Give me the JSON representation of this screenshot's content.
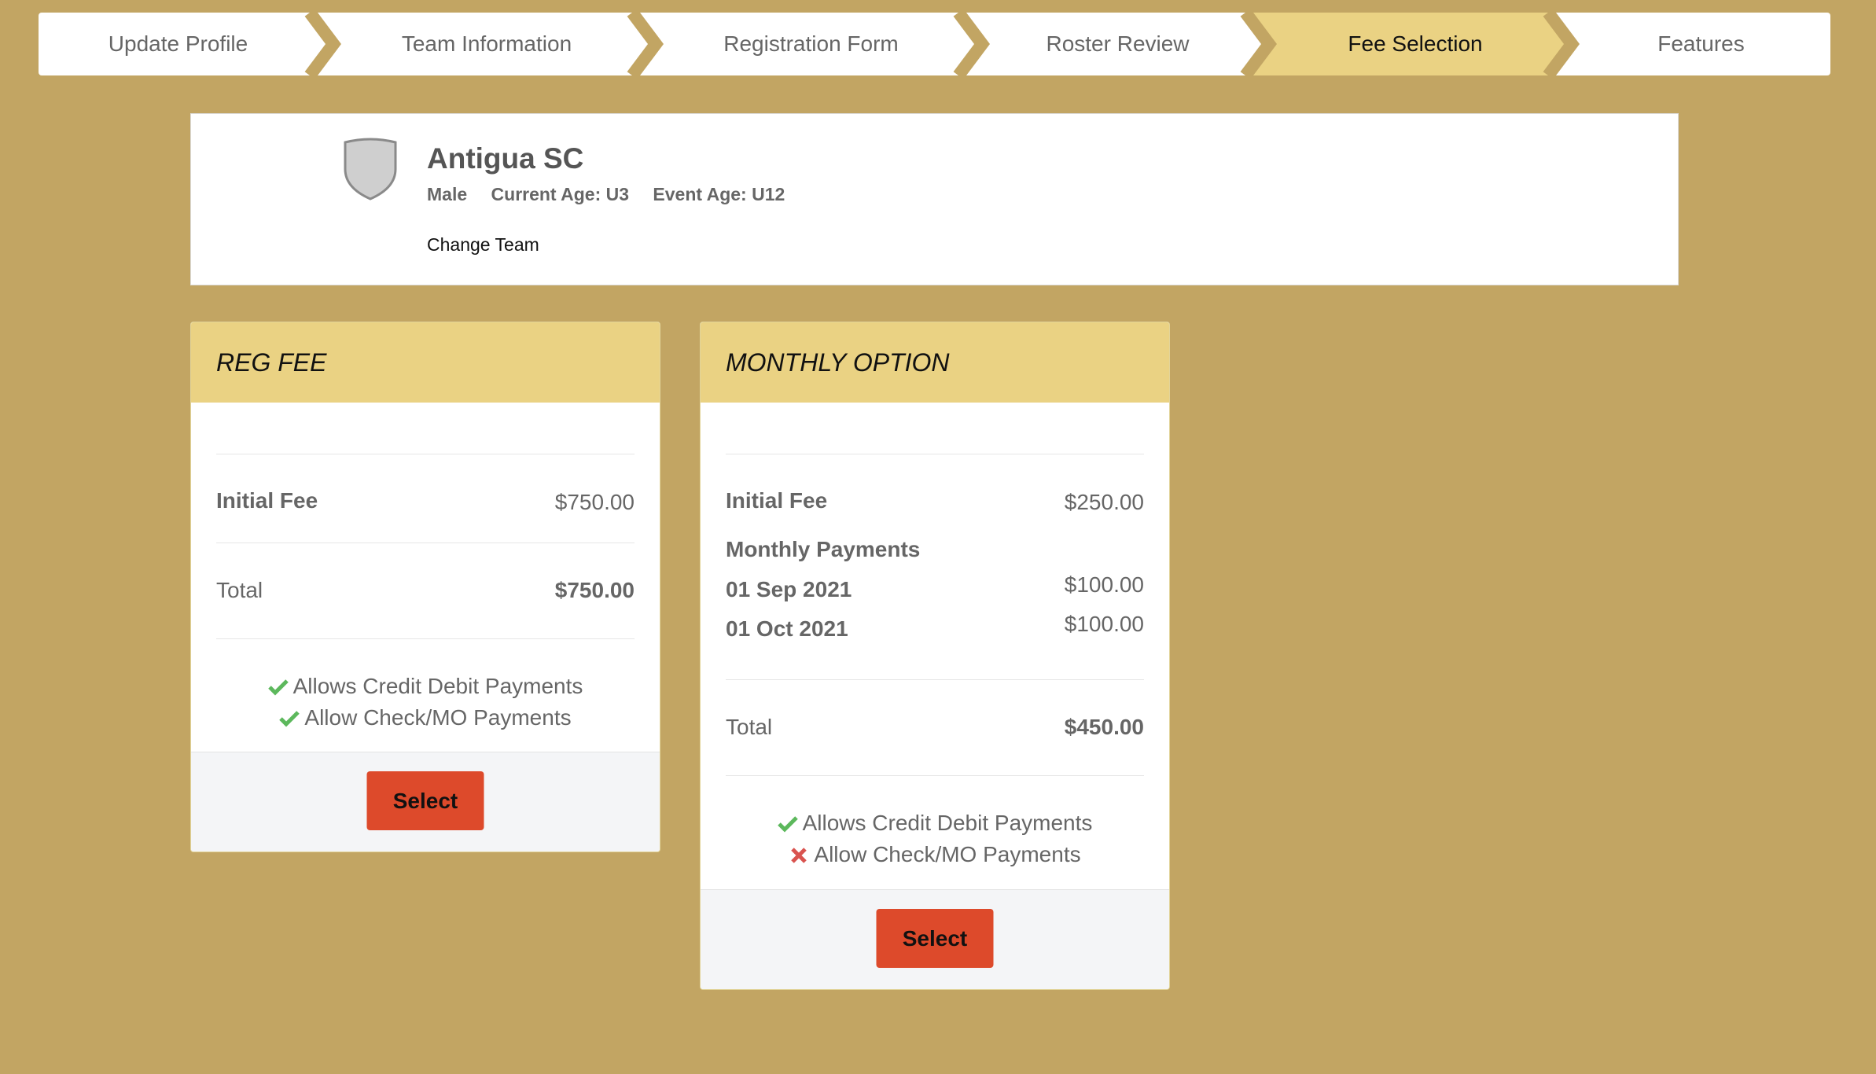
{
  "stepper": {
    "steps": [
      {
        "label": "Update Profile",
        "active": false
      },
      {
        "label": "Team Information",
        "active": false
      },
      {
        "label": "Registration Form",
        "active": false
      },
      {
        "label": "Roster Review",
        "active": false
      },
      {
        "label": "Fee Selection",
        "active": true
      },
      {
        "label": "Features",
        "active": false
      }
    ],
    "active_color": "#ead283"
  },
  "team": {
    "name": "Antigua SC",
    "gender": "Male",
    "current_age": "Current Age: U3",
    "event_age": "Event Age: U12",
    "change_label": "Change Team",
    "logo_icon": "shield-icon"
  },
  "fees": [
    {
      "title": "REG FEE",
      "initial_label": "Initial Fee",
      "initial_value": "$750.00",
      "total_label": "Total",
      "total_value": "$750.00",
      "allow_card": "Allows Credit Debit Payments",
      "allow_check": "Allow Check/MO Payments",
      "card_allowed": true,
      "check_allowed": true,
      "select_label": "Select"
    },
    {
      "title": "MONTHLY OPTION",
      "initial_label": "Initial Fee",
      "initial_value": "$250.00",
      "monthly_label": "Monthly Payments",
      "payments": [
        {
          "date": "01 Sep 2021",
          "amount": "$100.00"
        },
        {
          "date": "01 Oct 2021",
          "amount": "$100.00"
        }
      ],
      "total_label": "Total",
      "total_value": "$450.00",
      "allow_card": "Allows Credit Debit Payments",
      "allow_check": "Allow Check/MO Payments",
      "card_allowed": true,
      "check_allowed": false,
      "select_label": "Select"
    }
  ],
  "colors": {
    "background": "#c2a563",
    "header": "#ead283",
    "button": "#dd4a2b",
    "check": "#5cb85c",
    "cross": "#d9534f"
  }
}
